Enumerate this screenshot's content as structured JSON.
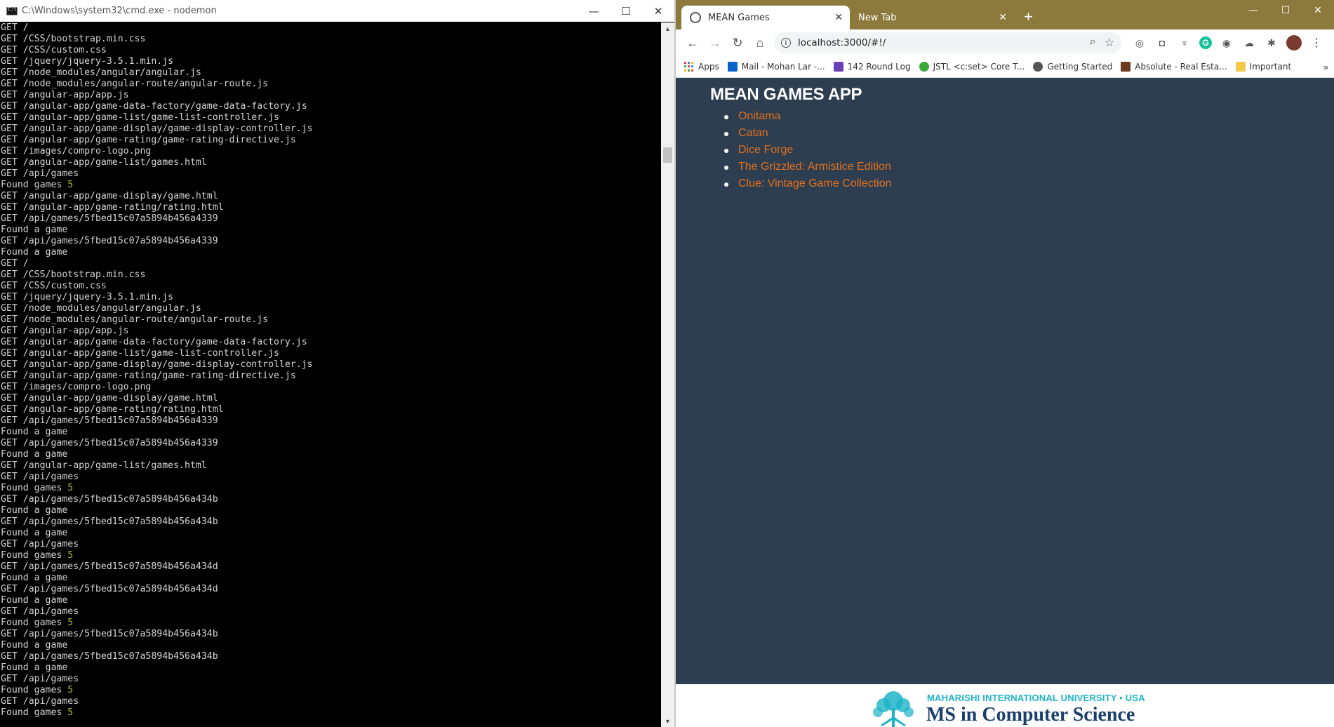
{
  "cmd": {
    "title": "C:\\Windows\\system32\\cmd.exe - nodemon",
    "controls": {
      "minimize": "—",
      "maximize": "☐",
      "close": "✕"
    },
    "lines": [
      [
        "GET /",
        ""
      ],
      [
        "GET /CSS/bootstrap.min.css",
        ""
      ],
      [
        "GET /CSS/custom.css",
        ""
      ],
      [
        "GET /jquery/jquery-3.5.1.min.js",
        ""
      ],
      [
        "GET /node_modules/angular/angular.js",
        ""
      ],
      [
        "GET /node_modules/angular-route/angular-route.js",
        ""
      ],
      [
        "GET /angular-app/app.js",
        ""
      ],
      [
        "GET /angular-app/game-data-factory/game-data-factory.js",
        ""
      ],
      [
        "GET /angular-app/game-list/game-list-controller.js",
        ""
      ],
      [
        "GET /angular-app/game-display/game-display-controller.js",
        ""
      ],
      [
        "GET /angular-app/game-rating/game-rating-directive.js",
        ""
      ],
      [
        "GET /images/compro-logo.png",
        ""
      ],
      [
        "GET /angular-app/game-list/games.html",
        ""
      ],
      [
        "GET /api/games",
        ""
      ],
      [
        "Found games ",
        "5"
      ],
      [
        "GET /angular-app/game-display/game.html",
        ""
      ],
      [
        "GET /angular-app/game-rating/rating.html",
        ""
      ],
      [
        "GET /api/games/5fbed15c07a5894b456a4339",
        ""
      ],
      [
        "Found a game",
        ""
      ],
      [
        "GET /api/games/5fbed15c07a5894b456a4339",
        ""
      ],
      [
        "Found a game",
        ""
      ],
      [
        "GET /",
        ""
      ],
      [
        "GET /CSS/bootstrap.min.css",
        ""
      ],
      [
        "GET /CSS/custom.css",
        ""
      ],
      [
        "GET /jquery/jquery-3.5.1.min.js",
        ""
      ],
      [
        "GET /node_modules/angular/angular.js",
        ""
      ],
      [
        "GET /node_modules/angular-route/angular-route.js",
        ""
      ],
      [
        "GET /angular-app/app.js",
        ""
      ],
      [
        "GET /angular-app/game-data-factory/game-data-factory.js",
        ""
      ],
      [
        "GET /angular-app/game-list/game-list-controller.js",
        ""
      ],
      [
        "GET /angular-app/game-display/game-display-controller.js",
        ""
      ],
      [
        "GET /angular-app/game-rating/game-rating-directive.js",
        ""
      ],
      [
        "GET /images/compro-logo.png",
        ""
      ],
      [
        "GET /angular-app/game-display/game.html",
        ""
      ],
      [
        "GET /angular-app/game-rating/rating.html",
        ""
      ],
      [
        "GET /api/games/5fbed15c07a5894b456a4339",
        ""
      ],
      [
        "Found a game",
        ""
      ],
      [
        "GET /api/games/5fbed15c07a5894b456a4339",
        ""
      ],
      [
        "Found a game",
        ""
      ],
      [
        "GET /angular-app/game-list/games.html",
        ""
      ],
      [
        "GET /api/games",
        ""
      ],
      [
        "Found games ",
        "5"
      ],
      [
        "GET /api/games/5fbed15c07a5894b456a434b",
        ""
      ],
      [
        "Found a game",
        ""
      ],
      [
        "GET /api/games/5fbed15c07a5894b456a434b",
        ""
      ],
      [
        "Found a game",
        ""
      ],
      [
        "GET /api/games",
        ""
      ],
      [
        "Found games ",
        "5"
      ],
      [
        "GET /api/games/5fbed15c07a5894b456a434d",
        ""
      ],
      [
        "Found a game",
        ""
      ],
      [
        "GET /api/games/5fbed15c07a5894b456a434d",
        ""
      ],
      [
        "Found a game",
        ""
      ],
      [
        "GET /api/games",
        ""
      ],
      [
        "Found games ",
        "5"
      ],
      [
        "GET /api/games/5fbed15c07a5894b456a434b",
        ""
      ],
      [
        "Found a game",
        ""
      ],
      [
        "GET /api/games/5fbed15c07a5894b456a434b",
        ""
      ],
      [
        "Found a game",
        ""
      ],
      [
        "GET /api/games",
        ""
      ],
      [
        "Found games ",
        "5"
      ],
      [
        "GET /api/games",
        ""
      ],
      [
        "Found games ",
        "5"
      ]
    ]
  },
  "browser": {
    "tabs": [
      {
        "title": "MEAN Games",
        "active": true
      },
      {
        "title": "New Tab",
        "active": false
      }
    ],
    "new_tab": "+",
    "controls": {
      "minimize": "—",
      "maximize": "☐",
      "close": "✕"
    },
    "url": "localhost:3000/#!/",
    "bookmarks": [
      {
        "label": "Apps",
        "icon_color": "#4285f4"
      },
      {
        "label": "Mail - Mohan Lar -...",
        "icon_color": "#0a64c8"
      },
      {
        "label": "142 Round Log",
        "icon_color": "#6a3fb5"
      },
      {
        "label": "JSTL <c:set> Core T...",
        "icon_color": "#3aa83a"
      },
      {
        "label": "Getting Started",
        "icon_color": "#555555"
      },
      {
        "label": "Absolute - Real Esta...",
        "icon_color": "#6b3a1a"
      },
      {
        "label": "Important",
        "icon_color": "#f2c94c"
      }
    ],
    "bookmarks_more": "»"
  },
  "app": {
    "title": "MEAN GAMES APP",
    "games": [
      "Onitama",
      "Catan",
      "Dice Forge",
      "The Grizzled: Armistice Edition",
      "Clue: Vintage Game Collection"
    ],
    "link_color": "#e36f1e",
    "background": "#2c3e50"
  },
  "footer": {
    "university": "MAHARISHI INTERNATIONAL UNIVERSITY • USA",
    "program": "MS in Computer Science"
  }
}
